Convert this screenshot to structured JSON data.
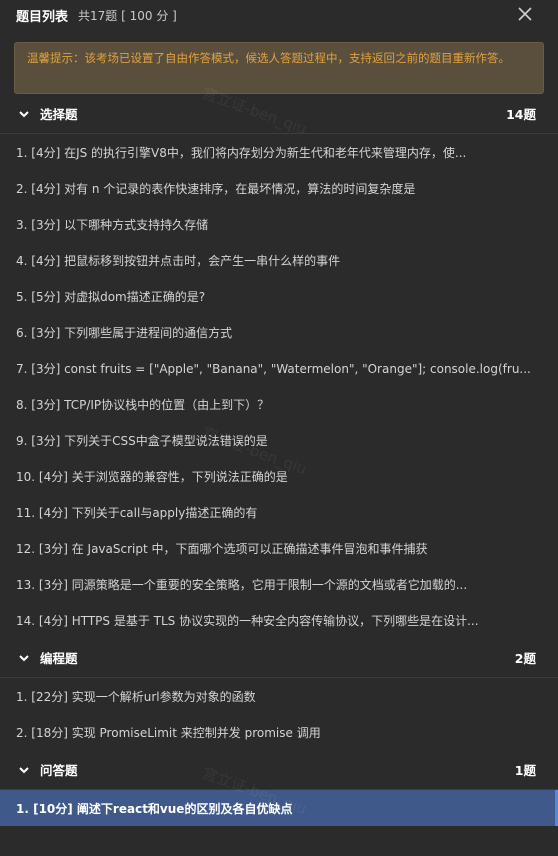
{
  "header": {
    "title": "题目列表",
    "count": "共17题 [ 100 分 ]"
  },
  "notice": "温馨提示：该考场已设置了自由作答模式，候选人答题过程中，支持返回之前的题目重新作答。",
  "sections": [
    {
      "title": "选择题",
      "count": "14题",
      "items": [
        "1. [4分] 在JS 的执行引擎V8中，我们将内存划分为新生代和老年代来管理内存，使...",
        "2. [4分] 对有 n 个记录的表作快速排序，在最坏情况，算法的时间复杂度是",
        "3. [3分] 以下哪种方式支持持久存储",
        "4. [4分] 把鼠标移到按钮并点击时，会产生一串什么样的事件",
        "5. [5分] 对虚拟dom描述正确的是?",
        "6. [3分] 下列哪些属于进程间的通信方式",
        "7. [3分] const fruits = [\"Apple\", \"Banana\", \"Watermelon\", \"Orange\"]; console.log(fru...",
        "8. [3分] TCP/IP协议栈中的位置（由上到下）？",
        "9. [3分] 下列关于CSS中盒子模型说法错误的是",
        "10. [4分] 关于浏览器的兼容性，下列说法正确的是",
        "11. [4分] 下列关于call与apply描述正确的有",
        "12. [3分] 在 JavaScript 中，下面哪个选项可以正确描述事件冒泡和事件捕获",
        "13. [3分] 同源策略是一个重要的安全策略，它用于限制一个源的文档或者它加载的...",
        "14. [4分] HTTPS 是基于 TLS 协议实现的一种安全内容传输协议，下列哪些是在设计..."
      ]
    },
    {
      "title": "编程题",
      "count": "2题",
      "items": [
        "1. [22分] 实现一个解析url参数为对象的函数",
        "2. [18分] 实现 PromiseLimit 来控制并发 promise 调用"
      ]
    },
    {
      "title": "问答题",
      "count": "1题",
      "items": [
        "1. [10分] 阐述下react和vue的区别及各自优缺点"
      ]
    }
  ],
  "watermark": "宫立证-ben_qiu",
  "colors": {
    "background": "#2b2b2b",
    "notice_bg": "#5a4f3c",
    "notice_text": "#e0a13f",
    "active_bg": "#3f5a8a",
    "active_border": "#5b86d6"
  },
  "icons": {
    "close": "close-icon",
    "section_toggle": "chevron-down-icon"
  }
}
